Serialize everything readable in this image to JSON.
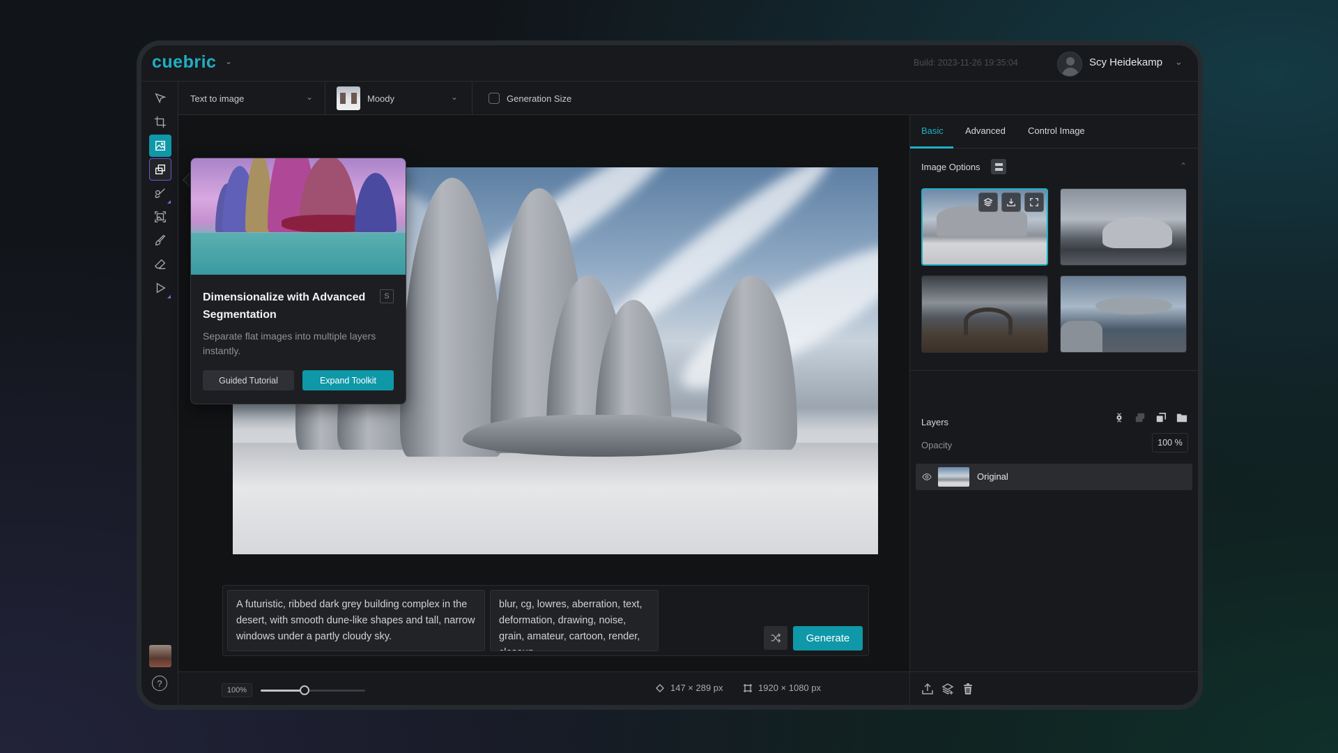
{
  "app": {
    "logo": "cuebric",
    "build": "Build: 2023-11-26 19:35:04",
    "user": {
      "name": "Scy Heidekamp"
    }
  },
  "toolbar": {
    "mode": "Text to image",
    "style": "Moody",
    "generation_size_label": "Generation Size",
    "generation_size_checked": false
  },
  "tools": [
    {
      "name": "select",
      "icon": "cursor-arrow-icon"
    },
    {
      "name": "crop",
      "icon": "crop-icon"
    },
    {
      "name": "generate-image",
      "icon": "image-generate-icon",
      "state": "active"
    },
    {
      "name": "segmentation",
      "icon": "layers-copy-icon",
      "state": "selected"
    },
    {
      "name": "inpaint",
      "icon": "paint-brush-icon"
    },
    {
      "name": "outpaint",
      "icon": "image-frame-icon"
    },
    {
      "name": "brush",
      "icon": "brush-icon"
    },
    {
      "name": "eraser",
      "icon": "eraser-icon"
    },
    {
      "name": "play",
      "icon": "play-icon"
    }
  ],
  "popover": {
    "title": "Dimensionalize with Advanced Segmentation",
    "shortcut": "S",
    "description": "Separate flat images into multiple layers instantly.",
    "secondary_button": "Guided Tutorial",
    "primary_button": "Expand Toolkit"
  },
  "prompt": {
    "positive": "A futuristic, ribbed dark grey building complex in the desert, with smooth dune-like shapes and tall, narrow windows under a partly cloudy sky.",
    "negative": "blur, cg, lowres, aberration, text, deformation, drawing, noise, grain, amateur, cartoon, render, closeup",
    "generate_label": "Generate"
  },
  "status": {
    "zoom": "100%",
    "zoom_level": 0.42,
    "selection_size": "147 × 289 px",
    "canvas_size": "1920 × 1080 px"
  },
  "right_panel": {
    "tabs": [
      {
        "label": "Basic",
        "active": true
      },
      {
        "label": "Advanced",
        "active": false
      },
      {
        "label": "Control Image",
        "active": false
      }
    ],
    "image_options_title": "Image Options",
    "gallery": [
      {
        "desc": "ribbed dune buildings in desert",
        "selected": true
      },
      {
        "desc": "domed shell building on rocky ground",
        "selected": false
      },
      {
        "desc": "arched ribbed structure under storm clouds",
        "selected": false
      },
      {
        "desc": "floating saucer-like structure over rocks",
        "selected": false
      }
    ],
    "gallery_actions": [
      "add-to-layers",
      "download",
      "fullscreen"
    ],
    "layers_title": "Layers",
    "opacity_label": "Opacity",
    "opacity_value": "100 %",
    "layers": [
      {
        "name": "Original",
        "visible": true
      }
    ]
  }
}
